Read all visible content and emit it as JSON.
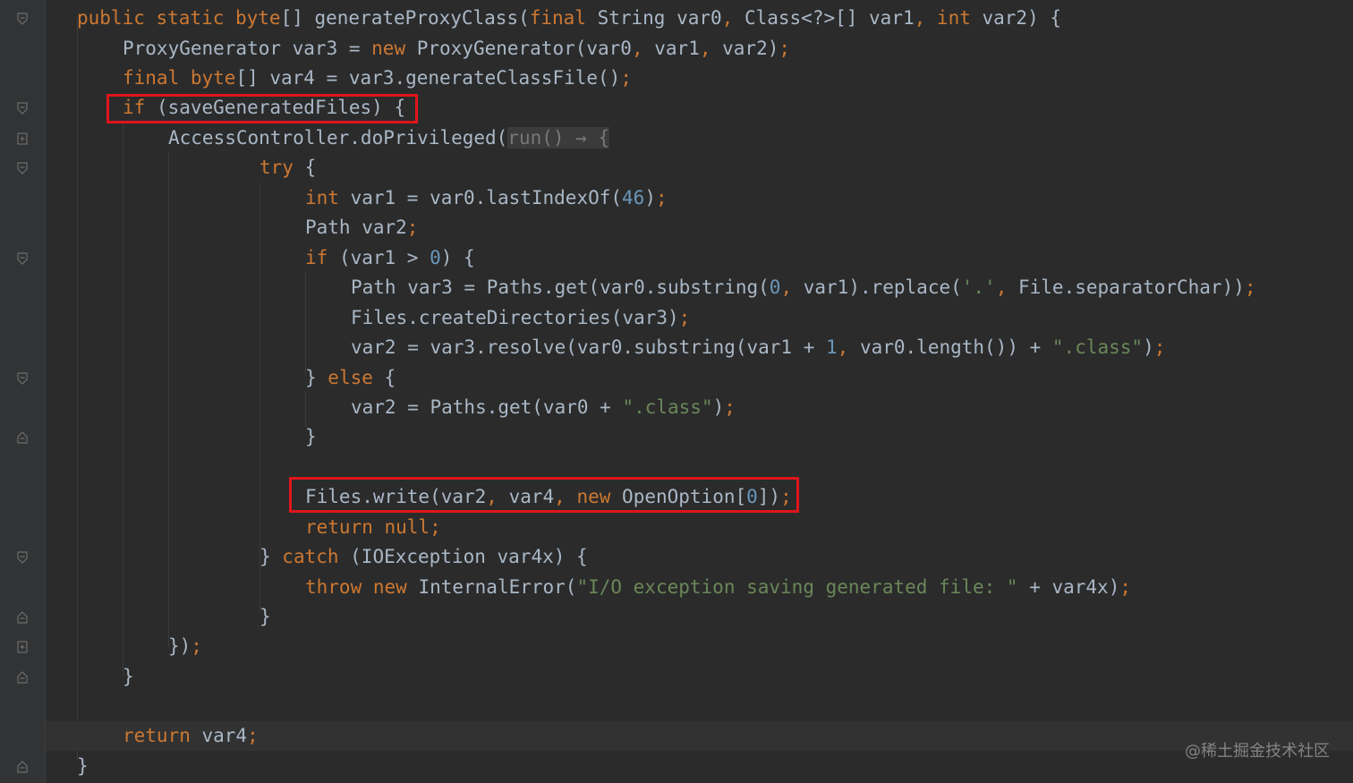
{
  "editor": {
    "lines": [
      [
        {
          "t": "public static byte",
          "c": "kw"
        },
        {
          "t": "[] generateProxyClass(",
          "c": "plain"
        },
        {
          "t": "final",
          "c": "kw"
        },
        {
          "t": " String var0",
          "c": "plain"
        },
        {
          "t": ", ",
          "c": "kw"
        },
        {
          "t": "Class<?>[] var1",
          "c": "plain"
        },
        {
          "t": ", ",
          "c": "kw"
        },
        {
          "t": "int",
          "c": "kw"
        },
        {
          "t": " var2) {",
          "c": "plain"
        }
      ],
      [
        {
          "t": "ProxyGenerator var3 = ",
          "c": "plain"
        },
        {
          "t": "new",
          "c": "kw"
        },
        {
          "t": " ProxyGenerator(var0",
          "c": "plain"
        },
        {
          "t": ", ",
          "c": "kw"
        },
        {
          "t": "var1",
          "c": "plain"
        },
        {
          "t": ", ",
          "c": "kw"
        },
        {
          "t": "var2)",
          "c": "plain"
        },
        {
          "t": ";",
          "c": "kw"
        }
      ],
      [
        {
          "t": "final byte",
          "c": "kw"
        },
        {
          "t": "[] var4 = var3.generateClassFile()",
          "c": "plain"
        },
        {
          "t": ";",
          "c": "kw"
        }
      ],
      [
        {
          "t": "if",
          "c": "kw"
        },
        {
          "t": " (saveGeneratedFiles) {",
          "c": "plain"
        }
      ],
      [
        {
          "t": "AccessController.doPrivileged(",
          "c": "plain"
        },
        {
          "t": "run() → {",
          "c": "hint"
        }
      ],
      [
        {
          "t": "try",
          "c": "kw"
        },
        {
          "t": " {",
          "c": "plain"
        }
      ],
      [
        {
          "t": "int",
          "c": "kw"
        },
        {
          "t": " var1 = var0.lastIndexOf(",
          "c": "plain"
        },
        {
          "t": "46",
          "c": "num"
        },
        {
          "t": ")",
          "c": "plain"
        },
        {
          "t": ";",
          "c": "kw"
        }
      ],
      [
        {
          "t": "Path var2",
          "c": "plain"
        },
        {
          "t": ";",
          "c": "kw"
        }
      ],
      [
        {
          "t": "if",
          "c": "kw"
        },
        {
          "t": " (var1 > ",
          "c": "plain"
        },
        {
          "t": "0",
          "c": "num"
        },
        {
          "t": ") {",
          "c": "plain"
        }
      ],
      [
        {
          "t": "Path var3 = Paths.get(var0.substring(",
          "c": "plain"
        },
        {
          "t": "0",
          "c": "num"
        },
        {
          "t": ", ",
          "c": "kw"
        },
        {
          "t": "var1).replace(",
          "c": "plain"
        },
        {
          "t": "'.'",
          "c": "str"
        },
        {
          "t": ", ",
          "c": "kw"
        },
        {
          "t": "File.separatorChar))",
          "c": "plain"
        },
        {
          "t": ";",
          "c": "kw"
        }
      ],
      [
        {
          "t": "Files.createDirectories(var3)",
          "c": "plain"
        },
        {
          "t": ";",
          "c": "kw"
        }
      ],
      [
        {
          "t": "var2 = var3.resolve(var0.substring(var1 + ",
          "c": "plain"
        },
        {
          "t": "1",
          "c": "num"
        },
        {
          "t": ", ",
          "c": "kw"
        },
        {
          "t": "var0.length()) + ",
          "c": "plain"
        },
        {
          "t": "\".class\"",
          "c": "str"
        },
        {
          "t": ")",
          "c": "plain"
        },
        {
          "t": ";",
          "c": "kw"
        }
      ],
      [
        {
          "t": "} ",
          "c": "plain"
        },
        {
          "t": "else",
          "c": "kw"
        },
        {
          "t": " {",
          "c": "plain"
        }
      ],
      [
        {
          "t": "var2 = Paths.get(var0 + ",
          "c": "plain"
        },
        {
          "t": "\".class\"",
          "c": "str"
        },
        {
          "t": ")",
          "c": "plain"
        },
        {
          "t": ";",
          "c": "kw"
        }
      ],
      [
        {
          "t": "}",
          "c": "plain"
        }
      ],
      [],
      [
        {
          "t": "Files.write(var2",
          "c": "plain"
        },
        {
          "t": ", ",
          "c": "kw"
        },
        {
          "t": "var4",
          "c": "plain"
        },
        {
          "t": ", ",
          "c": "kw"
        },
        {
          "t": "new",
          "c": "kw"
        },
        {
          "t": " OpenOption[",
          "c": "plain"
        },
        {
          "t": "0",
          "c": "num"
        },
        {
          "t": "])",
          "c": "plain"
        },
        {
          "t": ";",
          "c": "kw"
        }
      ],
      [
        {
          "t": "return null;",
          "c": "kw"
        }
      ],
      [
        {
          "t": "} ",
          "c": "plain"
        },
        {
          "t": "catch",
          "c": "kw"
        },
        {
          "t": " (IOException var4x) {",
          "c": "plain"
        }
      ],
      [
        {
          "t": "throw new",
          "c": "kw"
        },
        {
          "t": " InternalError(",
          "c": "plain"
        },
        {
          "t": "\"I/O exception saving generated file: \"",
          "c": "str"
        },
        {
          "t": " + var4x)",
          "c": "plain"
        },
        {
          "t": ";",
          "c": "kw"
        }
      ],
      [
        {
          "t": "}",
          "c": "plain"
        }
      ],
      [
        {
          "t": "})",
          "c": "plain"
        },
        {
          "t": ";",
          "c": "kw"
        }
      ],
      [
        {
          "t": "}",
          "c": "plain"
        }
      ],
      [],
      [
        {
          "t": "return",
          "c": "kw"
        },
        {
          "t": " var4",
          "c": "plain"
        },
        {
          "t": ";",
          "c": "kw"
        }
      ],
      [
        {
          "t": "}",
          "c": "plain"
        }
      ]
    ],
    "colors": {
      "background": "#2b2b2b",
      "keyword": "#cc7832",
      "number": "#6897bb",
      "string": "#6a8759",
      "text": "#a9b7c6",
      "highlight_box": "#e0151c"
    }
  },
  "watermark": "@稀土掘金技术社区"
}
